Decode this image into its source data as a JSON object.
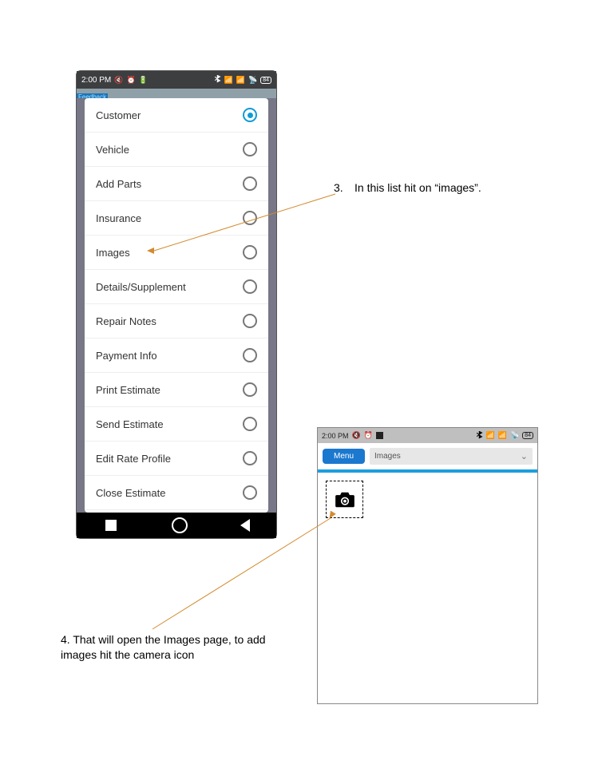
{
  "status": {
    "time": "2:00 PM",
    "battery_label": "84"
  },
  "feedback_label": "Feedback",
  "menu_items": [
    {
      "label": "Customer",
      "selected": true
    },
    {
      "label": "Vehicle",
      "selected": false
    },
    {
      "label": "Add Parts",
      "selected": false
    },
    {
      "label": "Insurance",
      "selected": false
    },
    {
      "label": "Images",
      "selected": false
    },
    {
      "label": "Details/Supplement",
      "selected": false
    },
    {
      "label": "Repair Notes",
      "selected": false
    },
    {
      "label": "Payment Info",
      "selected": false
    },
    {
      "label": "Print Estimate",
      "selected": false
    },
    {
      "label": "Send Estimate",
      "selected": false
    },
    {
      "label": "Edit Rate Profile",
      "selected": false
    },
    {
      "label": "Close Estimate",
      "selected": false
    }
  ],
  "phone2": {
    "menu_label": "Menu",
    "dropdown_label": "Images"
  },
  "annotations": {
    "step3_num": "3.",
    "step3": "In this list hit on “images”.",
    "step4": "4.  That will open the Images page, to add images hit the camera icon"
  }
}
